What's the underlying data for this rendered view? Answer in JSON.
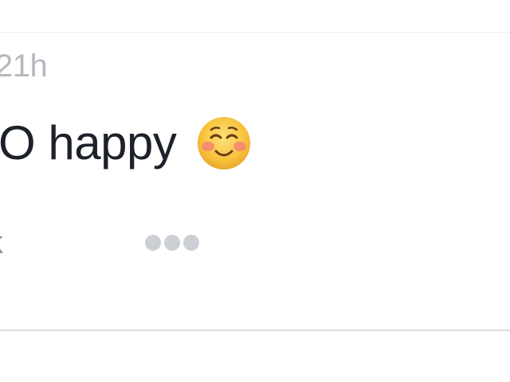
{
  "post": {
    "timestamp": "21h",
    "text": "O happy",
    "emoji_icon": "smiling-face-with-blush-icon",
    "action_partial": "k",
    "more_icon": "more-options-icon"
  },
  "colors": {
    "timestamp": "#b5b9be",
    "text": "#1d2129",
    "dots": "#ccd0d5",
    "emoji_face": "#f7c23c",
    "emoji_blush": "#f27b7b"
  }
}
